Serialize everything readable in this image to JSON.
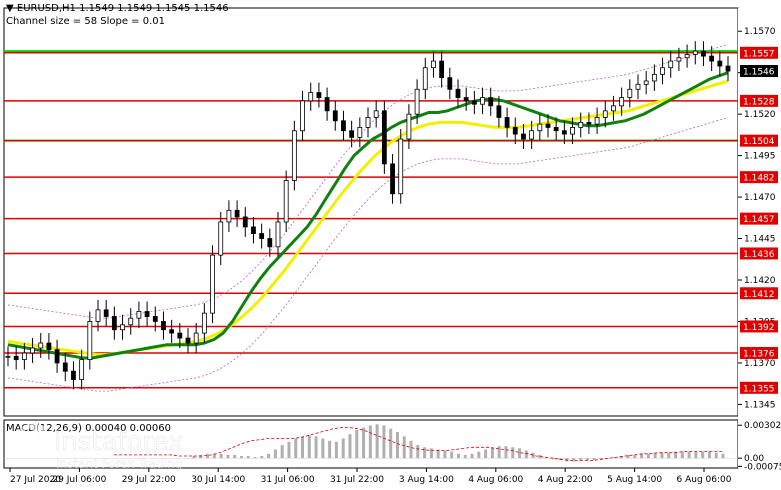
{
  "header": {
    "symbol_line": "EURUSD,H1  1.1549 1.1549 1.1545 1.1546",
    "channel_line": "Channel size = 58 Slope = 0.01"
  },
  "watermark": {
    "brand": "instaforex",
    "tagline": "Instant Forex Trading"
  },
  "colors": {
    "candle": "#000000",
    "level_red": "#e00000",
    "level_green": "#00d000",
    "ma_fast": "#108010",
    "ma_slow": "#f0f000",
    "envelope": "#c060c0",
    "macd_hist": "#b0b0b0",
    "macd_signal": "#e00000"
  },
  "chart_data": [
    {
      "type": "line",
      "title": "EURUSD,H1",
      "ylim": [
        1.1338,
        1.1584
      ],
      "y_ticks": [
        "1.1570",
        "1.1545",
        "1.1520",
        "1.1495",
        "1.1470",
        "1.1445",
        "1.1420",
        "1.1395",
        "1.1370",
        "1.1345"
      ],
      "x_ticks": [
        "27 Jul 2020",
        "29 Jul 06:00",
        "29 Jul 22:00",
        "30 Jul 14:00",
        "31 Jul 06:00",
        "31 Jul 22:00",
        "3 Aug 14:00",
        "4 Aug 06:00",
        "4 Aug 22:00",
        "5 Aug 14:00",
        "6 Aug 06:00"
      ],
      "price_levels": [
        {
          "label": "1.1557",
          "value": 1.1557,
          "color": "red"
        },
        {
          "label": "1.1546",
          "value": 1.1546,
          "color": "black"
        },
        {
          "label": "1.1528",
          "value": 1.1528,
          "color": "red"
        },
        {
          "label": "1.1504",
          "value": 1.1504,
          "color": "red"
        },
        {
          "label": "1.1482",
          "value": 1.1482,
          "color": "red"
        },
        {
          "label": "1.1457",
          "value": 1.1457,
          "color": "red"
        },
        {
          "label": "1.1436",
          "value": 1.1436,
          "color": "red"
        },
        {
          "label": "1.1412",
          "value": 1.1412,
          "color": "red"
        },
        {
          "label": "1.1392",
          "value": 1.1392,
          "color": "red"
        },
        {
          "label": "1.1376",
          "value": 1.1376,
          "color": "red"
        },
        {
          "label": "1.1355",
          "value": 1.1355,
          "color": "red"
        }
      ],
      "green_lines": [
        1.1558,
        1.1504
      ],
      "price_close": [
        1.1374,
        1.1372,
        1.1376,
        1.1379,
        1.1382,
        1.1378,
        1.137,
        1.1365,
        1.136,
        1.1372,
        1.1395,
        1.1402,
        1.1398,
        1.139,
        1.1393,
        1.1397,
        1.1401,
        1.1398,
        1.1395,
        1.139,
        1.1388,
        1.1385,
        1.1382,
        1.1388,
        1.14,
        1.1435,
        1.1455,
        1.1462,
        1.1458,
        1.1452,
        1.1448,
        1.1445,
        1.144,
        1.1455,
        1.148,
        1.151,
        1.1528,
        1.1533,
        1.153,
        1.1522,
        1.1516,
        1.151,
        1.1506,
        1.1512,
        1.1518,
        1.1522,
        1.149,
        1.1472,
        1.1505,
        1.152,
        1.1535,
        1.1548,
        1.1552,
        1.1542,
        1.1535,
        1.153,
        1.1528,
        1.1526,
        1.153,
        1.1525,
        1.1518,
        1.1512,
        1.1508,
        1.1505,
        1.151,
        1.1514,
        1.1512,
        1.151,
        1.1508,
        1.1512,
        1.1515,
        1.1514,
        1.1518,
        1.1522,
        1.1525,
        1.153,
        1.1535,
        1.1538,
        1.154,
        1.1544,
        1.1548,
        1.1552,
        1.1554,
        1.1556,
        1.1558,
        1.1555,
        1.1552,
        1.1549,
        1.1546
      ],
      "ma_fast": [
        1.1381,
        1.138,
        1.1379,
        1.1378,
        1.1377,
        1.1376,
        1.1375,
        1.1374,
        1.1373,
        1.1373,
        1.1374,
        1.1375,
        1.1376,
        1.1377,
        1.1378,
        1.1379,
        1.138,
        1.1381,
        1.1381,
        1.1381,
        1.1381,
        1.1382,
        1.1384,
        1.1388,
        1.1395,
        1.1404,
        1.1413,
        1.1421,
        1.1428,
        1.1434,
        1.144,
        1.1446,
        1.1452,
        1.146,
        1.1469,
        1.1478,
        1.1487,
        1.1495,
        1.15,
        1.1505,
        1.1508,
        1.1512,
        1.1515,
        1.1517,
        1.1519,
        1.1521,
        1.1521,
        1.1522,
        1.1524,
        1.1526,
        1.1528,
        1.1529,
        1.1529,
        1.1528,
        1.1526,
        1.1524,
        1.1522,
        1.152,
        1.1518,
        1.1516,
        1.1515,
        1.1514,
        1.1513,
        1.1513,
        1.1514,
        1.1515,
        1.1516,
        1.1518,
        1.152,
        1.1523,
        1.1526,
        1.1529,
        1.1532,
        1.1535,
        1.1538,
        1.1541,
        1.1543,
        1.1545
      ],
      "ma_slow": [
        1.1383,
        1.1382,
        1.1381,
        1.138,
        1.1379,
        1.1378,
        1.1377,
        1.1376,
        1.1375,
        1.1375,
        1.1376,
        1.1377,
        1.1378,
        1.1379,
        1.138,
        1.1381,
        1.1382,
        1.1383,
        1.1385,
        1.1388,
        1.1392,
        1.1397,
        1.1403,
        1.141,
        1.1418,
        1.1426,
        1.1435,
        1.1444,
        1.1453,
        1.1462,
        1.1471,
        1.1479,
        1.1487,
        1.1494,
        1.15,
        1.1505,
        1.1509,
        1.1512,
        1.1514,
        1.1515,
        1.1515,
        1.1515,
        1.1514,
        1.1513,
        1.1512,
        1.1512,
        1.1512,
        1.1513,
        1.1514,
        1.1515,
        1.1516,
        1.1517,
        1.1518,
        1.1519,
        1.152,
        1.1521,
        1.1522,
        1.1524,
        1.1526,
        1.1528,
        1.153,
        1.1532,
        1.1534,
        1.1536,
        1.1538,
        1.154
      ]
    },
    {
      "type": "bar",
      "title": "MACD(12,26,9) 0.00040 0.00060",
      "ylim": [
        -0.0009,
        0.0035
      ],
      "y_ticks": [
        "0.00302",
        "0.00",
        "-0.00075"
      ],
      "histogram": [
        0.0002,
        0.0003,
        0.0004,
        0.0004,
        0.0004,
        0.0003,
        0.0003,
        0.0002,
        0.0002,
        0.0001,
        0.0002,
        0.0004,
        0.0008,
        0.0012,
        0.0015,
        0.0018,
        0.002,
        0.0021,
        0.002,
        0.0018,
        0.0016,
        0.0015,
        0.0018,
        0.0022,
        0.0026,
        0.0028,
        0.003,
        0.0031,
        0.003,
        0.0027,
        0.0024,
        0.002,
        0.0016,
        0.0012,
        0.001,
        0.0009,
        0.0008,
        0.0007,
        0.0006,
        0.0004,
        0.0003,
        0.0004,
        0.0006,
        0.0008,
        0.001,
        0.0011,
        0.0011,
        0.001,
        0.0009,
        0.0007,
        0.0005,
        0.0003,
        0.0001,
        -0.0001,
        -0.0002,
        -0.0003,
        -0.0003,
        -0.0002,
        -0.0002,
        -0.0002,
        -0.0001,
        0.0,
        0.0001,
        0.0002,
        0.0003,
        0.0003,
        0.0004,
        0.0004,
        0.0005,
        0.0005,
        0.0005,
        0.0006,
        0.0006,
        0.0006,
        0.0006,
        0.0006,
        0.0006,
        0.0005,
        0.0004
      ],
      "signal": [
        0.0003,
        0.0003,
        0.0003,
        0.0003,
        0.0003,
        0.0003,
        0.0003,
        0.0003,
        0.0002,
        0.0002,
        0.0002,
        0.0002,
        0.0003,
        0.0005,
        0.0008,
        0.0011,
        0.0014,
        0.0016,
        0.0017,
        0.0018,
        0.0018,
        0.0018,
        0.0018,
        0.0019,
        0.0021,
        0.0023,
        0.0025,
        0.0027,
        0.0028,
        0.0028,
        0.0027,
        0.0025,
        0.0022,
        0.0019,
        0.0016,
        0.0013,
        0.0011,
        0.0009,
        0.0008,
        0.0007,
        0.0007,
        0.0007,
        0.0008,
        0.0009,
        0.001,
        0.001,
        0.001,
        0.0009,
        0.0008,
        0.0007,
        0.0005,
        0.0004,
        0.0002,
        0.0001,
        0.0,
        -0.0001,
        -0.0002,
        -0.0002,
        -0.0002,
        -0.0002,
        -0.0001,
        0.0,
        0.0001,
        0.0002,
        0.0003,
        0.0004,
        0.0004,
        0.0005,
        0.0005,
        0.0005,
        0.0006,
        0.0006,
        0.0006,
        0.0006,
        0.0006,
        0.0006
      ]
    }
  ]
}
